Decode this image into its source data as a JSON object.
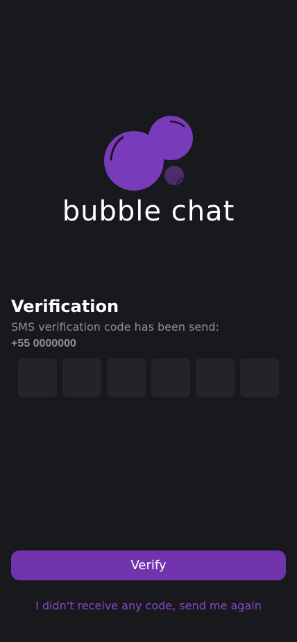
{
  "brand": {
    "app_name": "bubble chat",
    "accent_color": "#7a3bba",
    "logo_icon": "bubbles-logo-icon"
  },
  "verification": {
    "title": "Verification",
    "subtitle": "SMS verification code has been send:",
    "phone_number": "+55 0000000",
    "code_digits": [
      "",
      "",
      "",
      "",
      "",
      ""
    ]
  },
  "actions": {
    "verify_label": "Verify",
    "resend_label": "I didn't receive any code, send me again"
  },
  "colors": {
    "background": "#18191c",
    "input_background": "#222429",
    "button": "#7234ad",
    "link": "#8c46c9",
    "muted_text": "#8f9196"
  }
}
